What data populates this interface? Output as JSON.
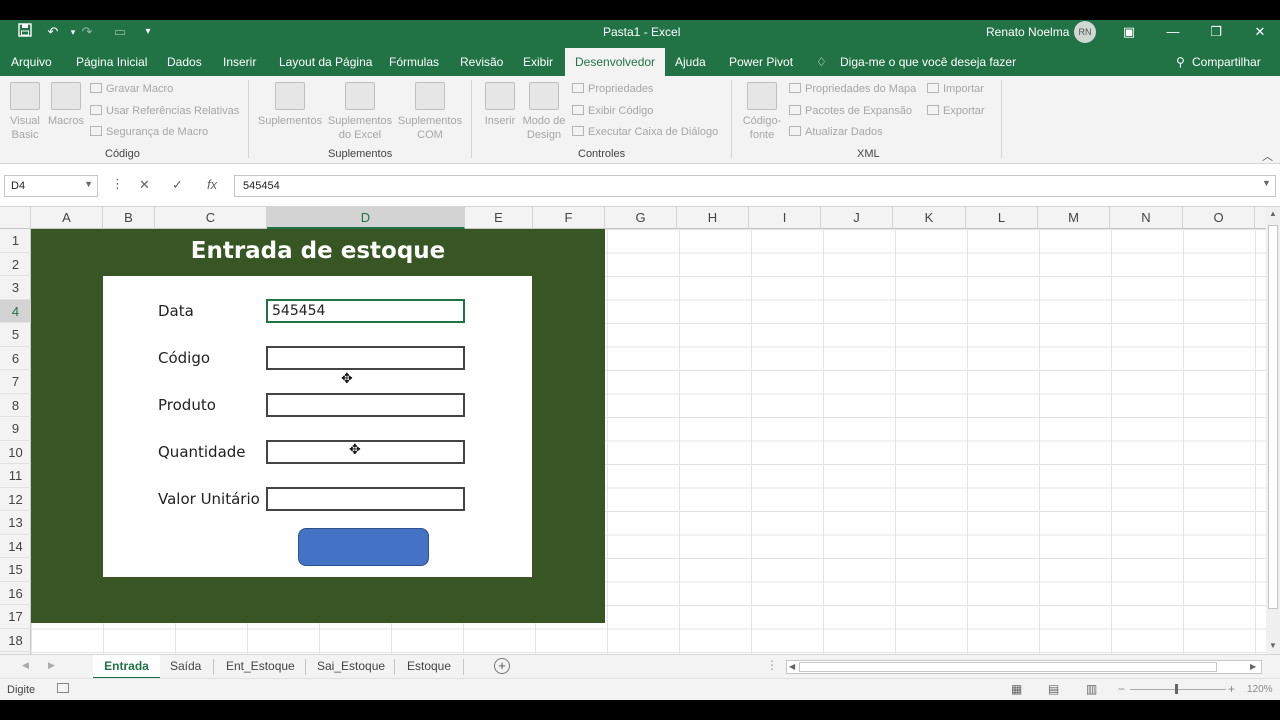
{
  "title_bar": {
    "title": "Pasta1  -  Excel",
    "user_name": "Renato Noelma",
    "user_initials": "RN",
    "qat_icons": [
      "save-icon",
      "undo-icon",
      "redo-icon",
      "form-icon",
      "customize-icon"
    ]
  },
  "ribbon_tabs": [
    {
      "label": "Arquivo"
    },
    {
      "label": "Página Inicial"
    },
    {
      "label": "Dados"
    },
    {
      "label": "Inserir"
    },
    {
      "label": "Layout da Página"
    },
    {
      "label": "Fórmulas"
    },
    {
      "label": "Revisão"
    },
    {
      "label": "Exibir"
    },
    {
      "label": "Desenvolvedor"
    },
    {
      "label": "Ajuda"
    },
    {
      "label": "Power Pivot"
    }
  ],
  "tell_me": "Diga-me o que você deseja fazer",
  "share": "Compartilhar",
  "ribbon": {
    "codigo": {
      "visual_basic": "Visual Basic",
      "macros": "Macros",
      "gravar_macro": "Gravar Macro",
      "usar_referencias": "Usar Referências Relativas",
      "seguranca_macro": "Segurança de Macro",
      "group": "Código"
    },
    "suplementos": {
      "suplementos": "Suplementos",
      "suplementos_excel": "Suplementos do Excel",
      "suplementos_com": "Suplementos COM",
      "group": "Suplementos"
    },
    "controles": {
      "inserir": "Inserir",
      "modo_design": "Modo de Design",
      "propriedades": "Propriedades",
      "exibir_codigo": "Exibir Código",
      "executar_caixa": "Executar Caixa de Diálogo",
      "group": "Controles"
    },
    "xml": {
      "codigo_fonte": "Código-fonte",
      "propriedades_mapa": "Propriedades do Mapa",
      "pacotes_expansao": "Pacotes de Expansão",
      "atualizar_dados": "Atualizar Dados",
      "importar": "Importar",
      "exportar": "Exportar",
      "group": "XML"
    }
  },
  "formula_bar": {
    "name_box": "D4",
    "value": "545454"
  },
  "columns": [
    "A",
    "B",
    "C",
    "D",
    "E",
    "F",
    "G",
    "H",
    "I",
    "J",
    "K",
    "L",
    "M",
    "N",
    "O"
  ],
  "rows": [
    "1",
    "2",
    "3",
    "4",
    "5",
    "6",
    "7",
    "8",
    "9",
    "10",
    "11",
    "12",
    "13",
    "14",
    "15",
    "16",
    "17",
    "18"
  ],
  "form": {
    "title": "Entrada de estoque",
    "fields": [
      {
        "label": "Data",
        "value": "545454"
      },
      {
        "label": "Código",
        "value": ""
      },
      {
        "label": "Produto",
        "value": ""
      },
      {
        "label": "Quantidade",
        "value": ""
      },
      {
        "label": "Valor Unitário",
        "value": ""
      }
    ]
  },
  "sheet_tabs": [
    {
      "label": "Entrada"
    },
    {
      "label": "Saída"
    },
    {
      "label": "Ent_Estoque"
    },
    {
      "label": "Sai_Estoque"
    },
    {
      "label": "Estoque"
    }
  ],
  "status": {
    "mode": "Digite",
    "zoom": "120%"
  },
  "colors": {
    "excel_green": "#217346",
    "form_background": "#375623",
    "button_blue": "#4472c4"
  }
}
